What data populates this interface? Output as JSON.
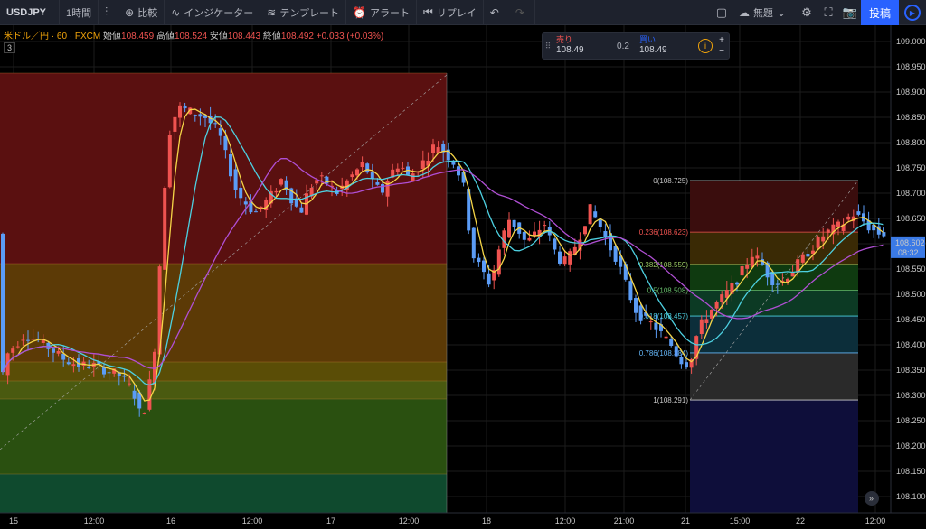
{
  "toolbar": {
    "symbol": "USDJPY",
    "interval": "1時間",
    "compare": "比較",
    "indicators": "インジケーター",
    "templates": "テンプレート",
    "alert": "アラート",
    "replay": "リプレイ",
    "layout_name": "無題",
    "publish": "投稿"
  },
  "legend": {
    "title": "米ドル／円 · 60 · FXCM",
    "open_label": "始値",
    "open": "108.459",
    "high_label": "高値",
    "high": "108.524",
    "low_label": "安値",
    "low": "108.443",
    "close_label": "終値",
    "close": "108.492",
    "change": "+0.033 (+0.03%)",
    "layer_count": "3"
  },
  "trade": {
    "sell_label": "売り",
    "sell_price": "108.49",
    "spread": "0.2",
    "buy_label": "買い",
    "buy_price": "108.49",
    "plus": "+",
    "minus": "−"
  },
  "price_axis": {
    "labels": [
      "109.000",
      "108.950",
      "108.900",
      "108.850",
      "108.800",
      "108.750",
      "108.700",
      "108.650",
      "108.600",
      "108.550",
      "108.500",
      "108.450",
      "108.400",
      "108.350",
      "108.300",
      "108.250",
      "108.200",
      "108.150",
      "108.100"
    ],
    "current_price": "108.602",
    "countdown": "08:32"
  },
  "time_axis": {
    "labels": [
      "15",
      "12:00",
      "16",
      "12:00",
      "17",
      "12:00",
      "18",
      "12:00",
      "21:00",
      "21",
      "15:00",
      "22",
      "12:00"
    ]
  },
  "fib_right": {
    "levels": [
      "0(108.725)",
      "0.236(108.623)",
      "0.382(108.559)",
      "0.5(108.508)",
      "0.618(108.457)",
      "0.786(108.384)",
      "1(108.291)"
    ]
  },
  "colors": {
    "up": "#ef5350",
    "down": "#5b9cf6",
    "ma_fast": "#f5d547",
    "ma_mid": "#4dd0e1",
    "ma_slow": "#b04fd4"
  }
}
